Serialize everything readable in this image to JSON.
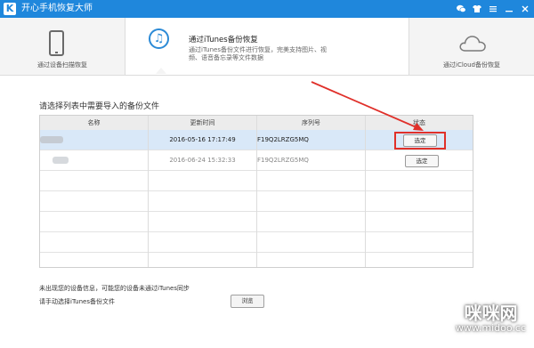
{
  "window": {
    "title": "开心手机恢复大师",
    "logo_letter": "K",
    "controls": [
      "chat-icon",
      "skin-icon",
      "menu-icon",
      "minimize-icon",
      "close-icon"
    ]
  },
  "modes": {
    "device": {
      "label": "通过设备扫描恢复",
      "icon": "phone-icon"
    },
    "itunes": {
      "title": "通过iTunes备份恢复",
      "description": "通过iTunes备份文件进行恢复，完美支持图片、视频、语音备忘录等文件数据",
      "icon": "music-note-icon"
    },
    "icloud": {
      "label": "通过iCloud备份恢复",
      "icon": "cloud-icon"
    }
  },
  "section_title": "请选择列表中需要导入的备份文件",
  "table": {
    "headers": [
      "名称",
      "更新时间",
      "序列号",
      "状态"
    ],
    "rows": [
      {
        "name": "",
        "time": "2016-05-16 17:17:49",
        "serial": "F19Q2LRZG5MQ",
        "action": "选定",
        "selected": true
      },
      {
        "name": "",
        "time": "2016-06-24 15:32:33",
        "serial": "F19Q2LRZG5MQ",
        "action": "选定",
        "selected": false
      }
    ]
  },
  "footer": {
    "line1": "未出现您的设备信息，可能您的设备未通过iTunes同步",
    "line2": "请手动选择iTunes备份文件",
    "browse_label": "浏览"
  },
  "watermark": {
    "line1": "咪咪网",
    "line2": "www.midoo.cc"
  },
  "colors": {
    "titlebar": "#1f87dc",
    "accent": "#2b8ad6",
    "selected_row": "#d9e8f8",
    "highlight": "#e0302a"
  }
}
